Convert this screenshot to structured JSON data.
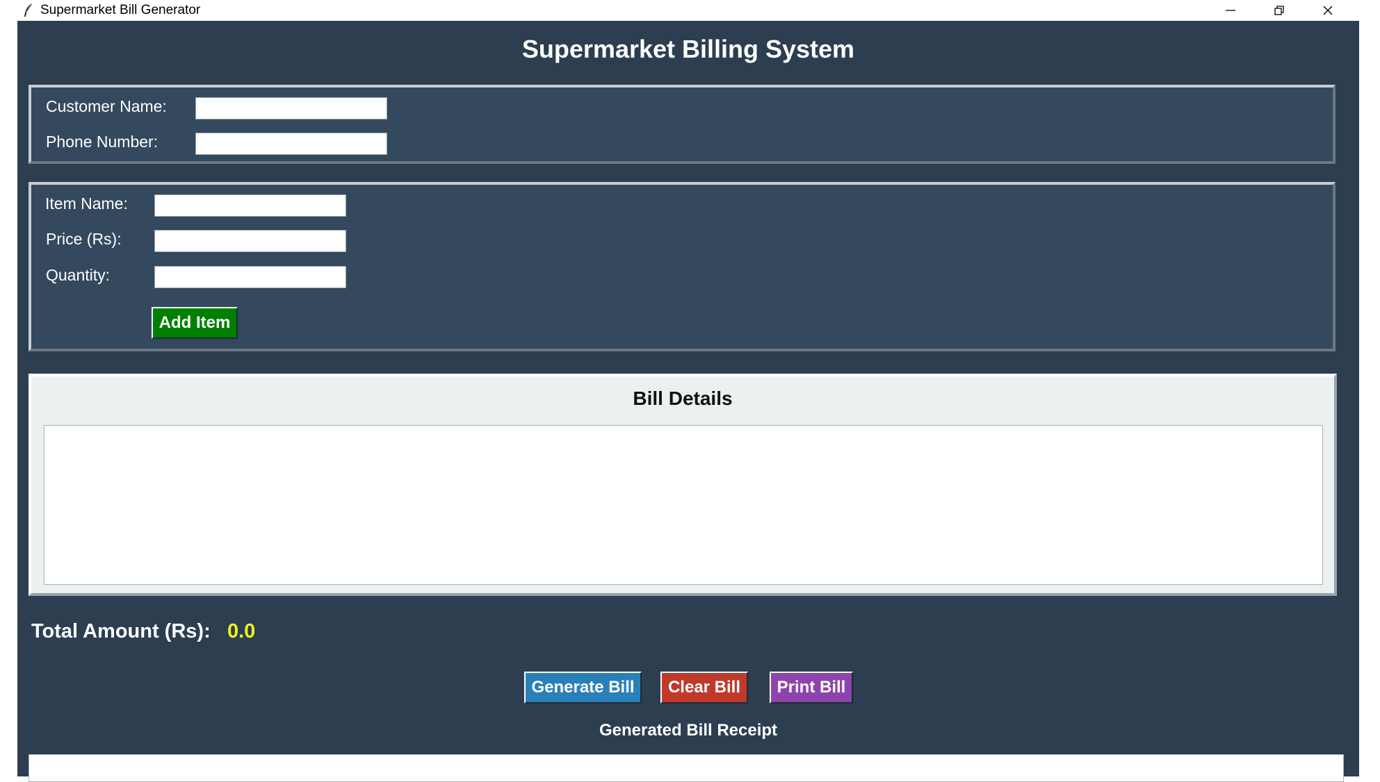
{
  "window": {
    "title": "Supermarket Bill Generator",
    "controls": [
      "minimize-icon",
      "restore-icon",
      "close-icon"
    ]
  },
  "header": {
    "title": "Supermarket Billing System"
  },
  "customer": {
    "name_label": "Customer Name:",
    "name_value": "",
    "phone_label": "Phone Number:",
    "phone_value": ""
  },
  "item": {
    "name_label": "Item Name:",
    "name_value": "",
    "price_label": "Price (Rs):",
    "price_value": "",
    "qty_label": "Quantity:",
    "qty_value": "",
    "add_label": "Add Item"
  },
  "bill": {
    "title": "Bill Details",
    "content": ""
  },
  "total": {
    "label": "Total Amount (Rs):",
    "value": "0.0"
  },
  "actions": {
    "generate_label": "Generate Bill",
    "clear_label": "Clear Bill",
    "print_label": "Print Bill"
  },
  "receipt": {
    "label": "Generated Bill Receipt",
    "content": ""
  },
  "colors": {
    "background": "#2c3e50",
    "panel": "#34495e",
    "add_button": "#008000",
    "generate_button": "#2980b9",
    "clear_button": "#c0392b",
    "print_button": "#8e44ad",
    "total_value": "#f1f120"
  }
}
